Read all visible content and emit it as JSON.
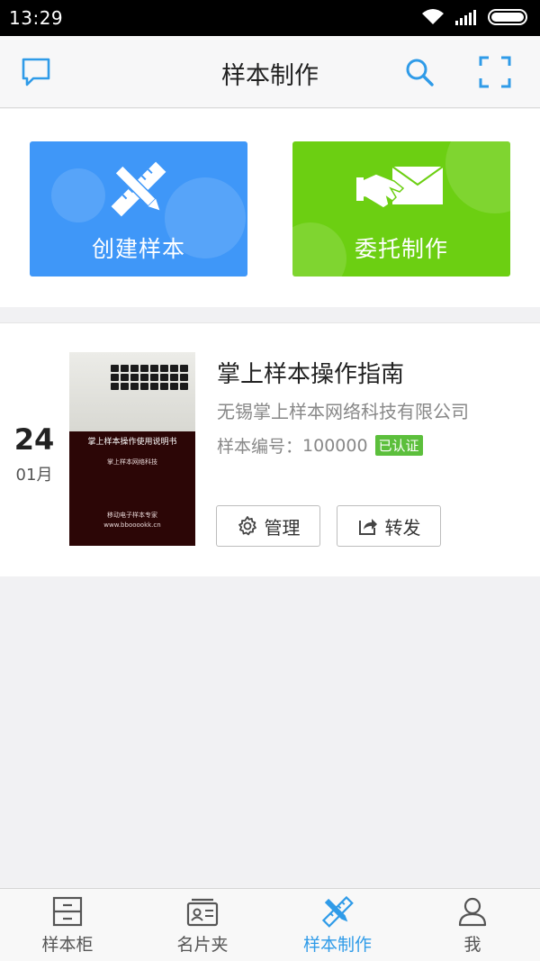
{
  "status_bar": {
    "time": "13:29"
  },
  "header": {
    "title": "样本制作"
  },
  "actions": {
    "create": {
      "label": "创建样本",
      "color": "#3f97f8"
    },
    "entrust": {
      "label": "委托制作",
      "color": "#6ccf12"
    }
  },
  "sample": {
    "day": "24",
    "month": "01月",
    "title": "掌上样本操作指南",
    "company": "无锡掌上样本网络科技有限公司",
    "number_label": "样本编号：",
    "number": "100000",
    "badge": "已认证",
    "thumbnail": {
      "title": "掌上样本操作使用说明书",
      "subtitle": "掌上样本网络科技",
      "footer_line1": "移动电子样本专家",
      "footer_line2": "www.bbooookk.cn"
    },
    "manage_label": "管理",
    "share_label": "转发"
  },
  "tabs": [
    {
      "label": "样本柜",
      "icon": "cabinet-icon",
      "active": false
    },
    {
      "label": "名片夹",
      "icon": "card-holder-icon",
      "active": false
    },
    {
      "label": "样本制作",
      "icon": "pencil-ruler-icon",
      "active": true
    },
    {
      "label": "我",
      "icon": "person-icon",
      "active": false
    }
  ],
  "colors": {
    "accent": "#2f9be8",
    "verified": "#5cbf3c"
  }
}
